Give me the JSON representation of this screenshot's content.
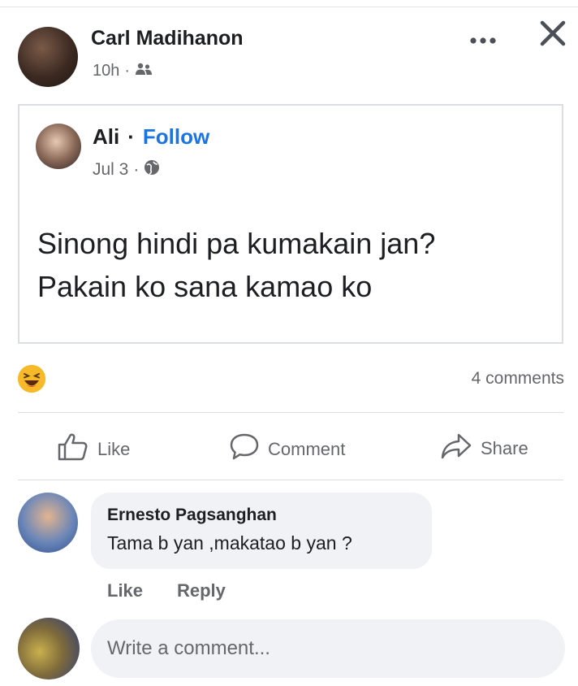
{
  "post": {
    "author": "Carl Madihanon",
    "time": "10h",
    "separator": "·",
    "audience_icon": "friends-icon"
  },
  "shared_post": {
    "author": "Ali",
    "dot": "·",
    "follow_label": "Follow",
    "date": "Jul 3",
    "separator": "·",
    "audience_icon": "globe-icon",
    "text": "Sinong hindi pa kumakain jan?\nPakain ko sana kamao ko"
  },
  "reactions": {
    "icon": "haha-reaction-icon",
    "comments_count": "4 comments"
  },
  "actions": {
    "like": "Like",
    "comment": "Comment",
    "share": "Share"
  },
  "comments": [
    {
      "name": "Ernesto Pagsanghan",
      "text": "Tama b yan ,makatao b yan ?",
      "like_label": "Like",
      "reply_label": "Reply"
    }
  ],
  "write_comment": {
    "placeholder": "Write a comment..."
  },
  "colors": {
    "accent": "#1b74e4",
    "secondary_text": "#65676b",
    "bubble": "#f0f2f5",
    "reaction": "#f7b928"
  }
}
